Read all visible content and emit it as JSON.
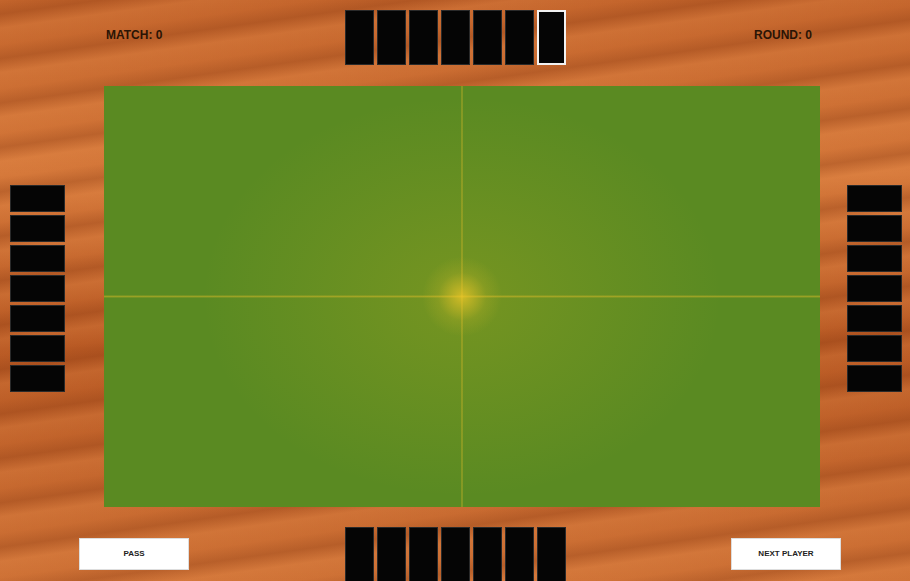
{
  "scores": {
    "match": "MATCH: 0",
    "round": "ROUND: 0"
  },
  "hands": {
    "north": [
      {
        "selected": false
      },
      {
        "selected": false
      },
      {
        "selected": false
      },
      {
        "selected": false
      },
      {
        "selected": false
      },
      {
        "selected": false
      },
      {
        "selected": true
      }
    ],
    "west": [
      {
        "selected": false
      },
      {
        "selected": false
      },
      {
        "selected": false
      },
      {
        "selected": false
      },
      {
        "selected": false
      },
      {
        "selected": false
      },
      {
        "selected": false
      }
    ],
    "east": [
      {
        "selected": false
      },
      {
        "selected": false
      },
      {
        "selected": false
      },
      {
        "selected": false
      },
      {
        "selected": false
      },
      {
        "selected": false
      },
      {
        "selected": false
      }
    ],
    "south": [
      {
        "selected": false
      },
      {
        "selected": false
      },
      {
        "selected": false
      },
      {
        "selected": false
      },
      {
        "selected": false
      },
      {
        "selected": false
      },
      {
        "selected": false
      }
    ]
  },
  "buttons": [
    "PASS",
    "NEXT PLAYER"
  ]
}
